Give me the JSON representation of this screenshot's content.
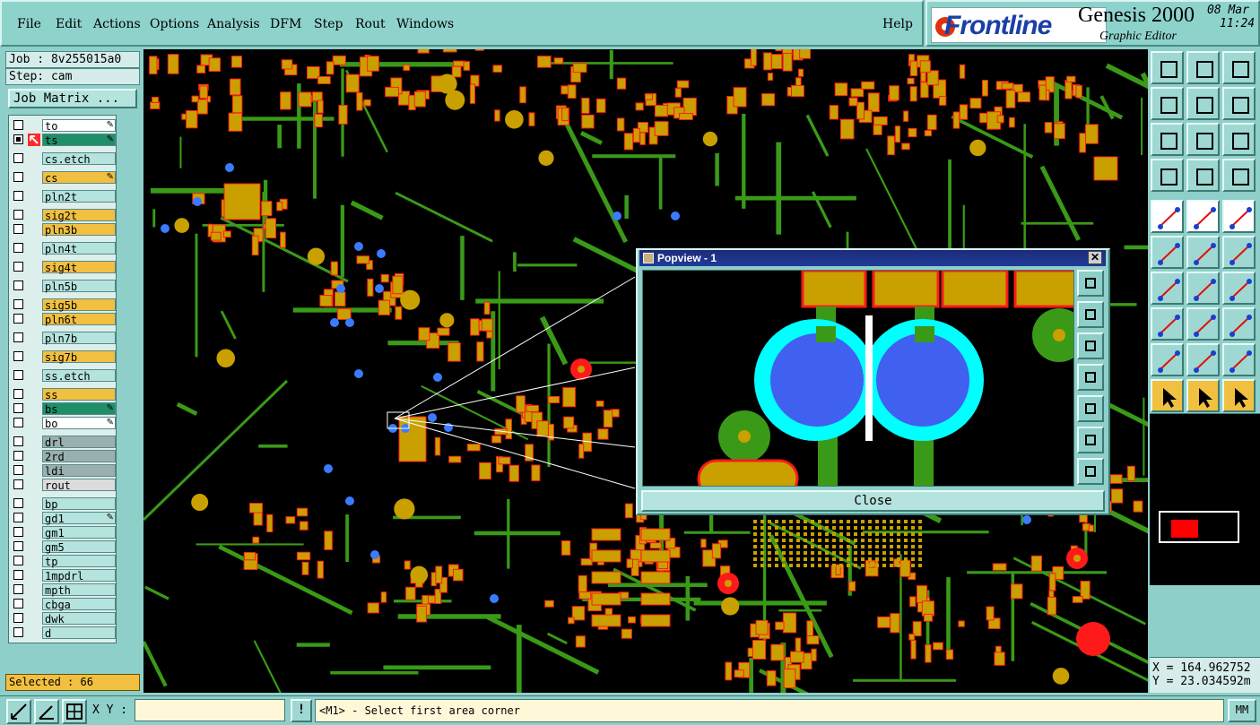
{
  "menu": {
    "items": [
      "File",
      "Edit",
      "Actions",
      "Options",
      "Analysis",
      "DFM",
      "Step",
      "Rout",
      "Windows"
    ],
    "help": "Help"
  },
  "brand": {
    "company": "Frontline",
    "product": "Genesis 2000",
    "subtitle": "Graphic Editor",
    "date": "08 Mar",
    "time": "11:24"
  },
  "left_panel": {
    "job": "Job : 8v255015a0",
    "step": "Step: cam",
    "job_matrix_button": "Job Matrix ...",
    "layers": [
      {
        "name": "to",
        "color": "#ffffff",
        "affected": false,
        "work": false,
        "edit": true
      },
      {
        "name": "ts",
        "color": "#1f8f6a",
        "affected": true,
        "work": true,
        "edit": true
      },
      {
        "name": "cs.etch",
        "color": "#b5e3de",
        "affected": false,
        "work": false,
        "edit": false
      },
      {
        "name": "cs",
        "color": "#f2c040",
        "affected": false,
        "work": false,
        "edit": true
      },
      {
        "name": "pln2t",
        "color": "#b5e3de",
        "affected": false,
        "work": false,
        "edit": false
      },
      {
        "name": "sig2t",
        "color": "#f2c040",
        "affected": false,
        "work": false,
        "edit": false
      },
      {
        "name": "pln3b",
        "color": "#f2c040",
        "affected": false,
        "work": false,
        "edit": false
      },
      {
        "name": "pln4t",
        "color": "#b5e3de",
        "affected": false,
        "work": false,
        "edit": false
      },
      {
        "name": "sig4t",
        "color": "#f2c040",
        "affected": false,
        "work": false,
        "edit": false
      },
      {
        "name": "pln5b",
        "color": "#b5e3de",
        "affected": false,
        "work": false,
        "edit": false
      },
      {
        "name": "sig5b",
        "color": "#f2c040",
        "affected": false,
        "work": false,
        "edit": false
      },
      {
        "name": "pln6t",
        "color": "#f2c040",
        "affected": false,
        "work": false,
        "edit": false
      },
      {
        "name": "pln7b",
        "color": "#b5e3de",
        "affected": false,
        "work": false,
        "edit": false
      },
      {
        "name": "sig7b",
        "color": "#f2c040",
        "affected": false,
        "work": false,
        "edit": false
      },
      {
        "name": "ss.etch",
        "color": "#b5e3de",
        "affected": false,
        "work": false,
        "edit": false
      },
      {
        "name": "ss",
        "color": "#f2c040",
        "affected": false,
        "work": false,
        "edit": false
      },
      {
        "name": "bs",
        "color": "#1f8f6a",
        "affected": false,
        "work": false,
        "edit": true
      },
      {
        "name": "bo",
        "color": "#ffffff",
        "affected": false,
        "work": false,
        "edit": true
      },
      {
        "name": "drl",
        "color": "#9ab0b0",
        "affected": false,
        "work": false,
        "edit": false
      },
      {
        "name": "2rd",
        "color": "#9ab0b0",
        "affected": false,
        "work": false,
        "edit": false
      },
      {
        "name": "ldi",
        "color": "#9ab0b0",
        "affected": false,
        "work": false,
        "edit": false
      },
      {
        "name": "rout",
        "color": "#dcdcdc",
        "affected": false,
        "work": false,
        "edit": false
      },
      {
        "name": "bp",
        "color": "#b5e3de",
        "affected": false,
        "work": false,
        "edit": false
      },
      {
        "name": "gd1",
        "color": "#b5e3de",
        "affected": false,
        "work": false,
        "edit": true
      },
      {
        "name": "gm1",
        "color": "#b5e3de",
        "affected": false,
        "work": false,
        "edit": false
      },
      {
        "name": "gm5",
        "color": "#b5e3de",
        "affected": false,
        "work": false,
        "edit": false
      },
      {
        "name": "tp",
        "color": "#b5e3de",
        "affected": false,
        "work": false,
        "edit": false
      },
      {
        "name": "1mpdrl",
        "color": "#b5e3de",
        "affected": false,
        "work": false,
        "edit": false
      },
      {
        "name": "mpth",
        "color": "#b5e3de",
        "affected": false,
        "work": false,
        "edit": false
      },
      {
        "name": "cbga",
        "color": "#b5e3de",
        "affected": false,
        "work": false,
        "edit": false
      },
      {
        "name": "dwk",
        "color": "#b5e3de",
        "affected": false,
        "work": false,
        "edit": false
      },
      {
        "name": "d",
        "color": "#b5e3de",
        "affected": false,
        "work": false,
        "edit": false
      }
    ],
    "selected": "Selected : 66"
  },
  "popview": {
    "title": "Popview - 1",
    "close_label": "Close"
  },
  "coords": {
    "x": "X = 164.962752",
    "y": "Y = 23.034592m"
  },
  "bottom": {
    "xy_label": "X Y :",
    "xy_value": "",
    "bang": "!",
    "prompt": "<M1> - Select first area corner",
    "units": "MM"
  },
  "colors": {
    "pad": "#c9a000",
    "pad_outline": "#ff1a1a",
    "trace": "#3a9a18",
    "via": "#3a7bff",
    "cyan": "#00ffff",
    "panel": "#8fcfc9"
  },
  "icons": {
    "toolbar": [
      "zoom-home-icon",
      "zoom-page-icon",
      "home-view-icon",
      "pan-left-icon",
      "pan-right-icon",
      "undo-view-icon",
      "fit-all-icon",
      "zoom-center-icon",
      "ratio-icon",
      "snap-icon",
      "grid-icon",
      "layers-icon",
      "measure-icon",
      "pencil-icon",
      "ruler-icon",
      "net-icon",
      "cross-icon",
      "line-icon",
      "arc-icon",
      "angle-icon",
      "rotate-icon",
      "add-icon",
      "dash-icon",
      "dimension-icon",
      "triangle-icon",
      "a-icon",
      "a-arc-icon",
      "select-icon",
      "select-box-icon",
      "select-circle-icon"
    ]
  }
}
